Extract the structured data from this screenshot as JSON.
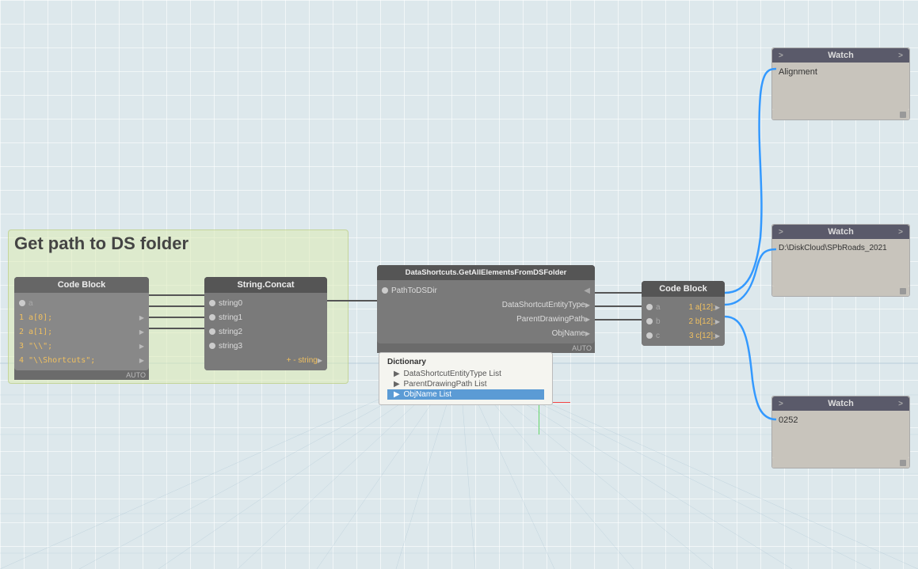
{
  "canvas": {
    "background_color": "#dde8ec"
  },
  "group": {
    "title": "Get path to DS folder"
  },
  "nodes": {
    "code_block_1": {
      "header": "Code Block",
      "port_left": "a",
      "lines": [
        "1 a[0];",
        "2 a[1];",
        "3 \"\\\\\";",
        "4 \"\\\\Shortcuts\";"
      ],
      "footer": "AUTO"
    },
    "string_concat": {
      "header": "String.Concat",
      "inputs": [
        "string0",
        "string1",
        "string2",
        "string3"
      ],
      "output": "+ - string"
    },
    "data_shortcuts": {
      "header": "DataShortcuts.GetAllElementsFromDSFolder",
      "input": "PathToDSDir",
      "outputs": [
        "DataShortcutEntityType",
        "ParentDrawingPath",
        "ObjName"
      ],
      "footer": "AUTO"
    },
    "code_block_2": {
      "header": "Code Block",
      "port_left_a": "a",
      "port_left_b": "b",
      "port_left_c": "c",
      "lines": [
        "1 a[12];",
        "2 b[12];",
        "3 c[12];"
      ],
      "footer": ""
    }
  },
  "watch_panels": {
    "watch1": {
      "title": "Watch",
      "port_left": ">",
      "port_right": ">",
      "content": "Alignment"
    },
    "watch2": {
      "title": "Watch",
      "port_left": ">",
      "port_right": ">",
      "content": "D:\\DiskCloud\\SPbRoads_2021"
    },
    "watch3": {
      "title": "Watch",
      "port_left": ">",
      "port_right": ">",
      "content": "0252"
    }
  },
  "dictionary_popup": {
    "title": "Dictionary",
    "items": [
      {
        "label": "DataShortcutEntityType List",
        "selected": false
      },
      {
        "label": "ParentDrawingPath List",
        "selected": false
      },
      {
        "label": "ObjName List",
        "selected": true
      }
    ]
  }
}
